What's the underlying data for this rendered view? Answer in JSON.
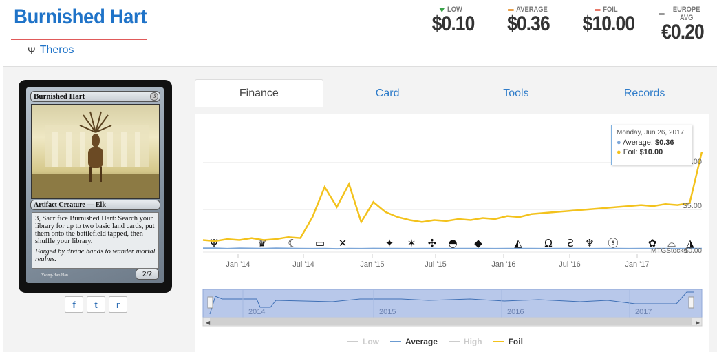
{
  "header": {
    "card_name": "Burnished Hart",
    "set_name": "Theros",
    "set_icon": "theros-set-icon"
  },
  "prices": [
    {
      "label": "LOW",
      "value": "$0.10",
      "indicator": "triangle-down",
      "color": "#3aa34a"
    },
    {
      "label": "AVERAGE",
      "value": "$0.36",
      "indicator": "dash",
      "color": "#e8a04a"
    },
    {
      "label": "FOIL",
      "value": "$10.00",
      "indicator": "dash",
      "color": "#e87a6a"
    },
    {
      "label": "EUROPE AVG",
      "value": "€0.20",
      "indicator": "dash",
      "color": "#999999"
    }
  ],
  "card_image": {
    "name": "Burnished Hart",
    "cost": "3",
    "type_line": "Artifact Creature — Elk",
    "rules_text": "3, Sacrifice Burnished Hart: Search your library for up to two basic land cards, put them onto the battlefield tapped, then shuffle your library.",
    "flavor_text": "Forged by divine hands to wander mortal realms.",
    "pt": "2/2",
    "artist": "Yeong-Hao Han"
  },
  "share": [
    {
      "name": "facebook",
      "glyph": "f"
    },
    {
      "name": "twitter",
      "glyph": "t"
    },
    {
      "name": "reddit",
      "glyph": "r"
    }
  ],
  "tabs": [
    {
      "label": "Finance",
      "active": true
    },
    {
      "label": "Card",
      "active": false
    },
    {
      "label": "Tools",
      "active": false
    },
    {
      "label": "Records",
      "active": false
    }
  ],
  "tooltip": {
    "date": "Monday, Jun 26, 2017",
    "average_label": "Average:",
    "average_value": "$0.36",
    "foil_label": "Foil:",
    "foil_value": "$10.00"
  },
  "chart_data": {
    "type": "line",
    "x_ticks": [
      "Jan '14",
      "Jul '14",
      "Jan '15",
      "Jul '15",
      "Jan '16",
      "Jul '16",
      "Jan '17"
    ],
    "navigator_ticks": [
      "2014",
      "2015",
      "2016",
      "2017"
    ],
    "y_tick_labels": [
      ".00",
      "$5.00",
      "$0.00"
    ],
    "watermark": "MTGStocks",
    "series": [
      {
        "name": "Low",
        "color": "#cccccc",
        "visible": false
      },
      {
        "name": "Average",
        "color": "#7ea7d8",
        "visible": true
      },
      {
        "name": "High",
        "color": "#cccccc",
        "visible": false
      },
      {
        "name": "Foil",
        "color": "#f3c21c",
        "visible": true
      }
    ],
    "foil_values": [
      1.2,
      1.1,
      1.3,
      1.2,
      1.4,
      1.2,
      1.3,
      1.5,
      1.4,
      3.5,
      6.5,
      4.5,
      6.8,
      3.0,
      5.0,
      4.0,
      3.5,
      3.2,
      3.0,
      3.2,
      3.1,
      3.3,
      3.2,
      3.4,
      3.3,
      3.6,
      3.5,
      3.8,
      3.9,
      4.0,
      4.1,
      4.2,
      4.3,
      4.4,
      4.5,
      4.6,
      4.7,
      4.6,
      4.8,
      4.7,
      4.9,
      10.0
    ],
    "average_values": [
      0.4,
      0.4,
      0.35,
      0.4,
      0.38,
      0.36,
      0.4,
      0.38,
      0.36,
      0.35,
      0.36,
      0.34,
      0.36,
      0.35,
      0.37,
      0.36,
      0.36,
      0.35,
      0.36,
      0.36,
      0.35,
      0.36,
      0.36,
      0.36,
      0.35,
      0.36,
      0.36,
      0.36,
      0.35,
      0.36,
      0.36,
      0.36,
      0.35,
      0.36,
      0.36,
      0.35,
      0.36,
      0.36,
      0.36,
      0.35,
      0.36,
      0.36
    ],
    "ylim": [
      0,
      11
    ]
  },
  "legend": [
    {
      "label": "Low",
      "color": "#cccccc",
      "active": false
    },
    {
      "label": "Average",
      "color": "#6b9bd1",
      "active": true
    },
    {
      "label": "High",
      "color": "#cccccc",
      "active": false
    },
    {
      "label": "Foil",
      "color": "#f3c21c",
      "active": true
    }
  ]
}
